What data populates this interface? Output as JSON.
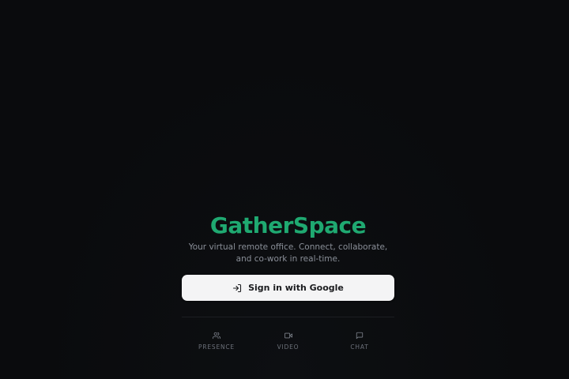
{
  "app": {
    "name": "GatherSpace",
    "tagline": "Your virtual remote office. Connect, collaborate, and co-work in real-time."
  },
  "auth": {
    "google_button_label": "Sign in with Google"
  },
  "features": [
    {
      "label": "PRESENCE",
      "icon": "users-icon"
    },
    {
      "label": "VIDEO",
      "icon": "video-icon"
    },
    {
      "label": "CHAT",
      "icon": "chat-icon"
    }
  ],
  "colors": {
    "background": "#0a0b0d",
    "brand": "#1fa971",
    "button_bg": "#f4f4f5",
    "muted_text": "#8a8f98",
    "feature_text": "#6c717a"
  }
}
